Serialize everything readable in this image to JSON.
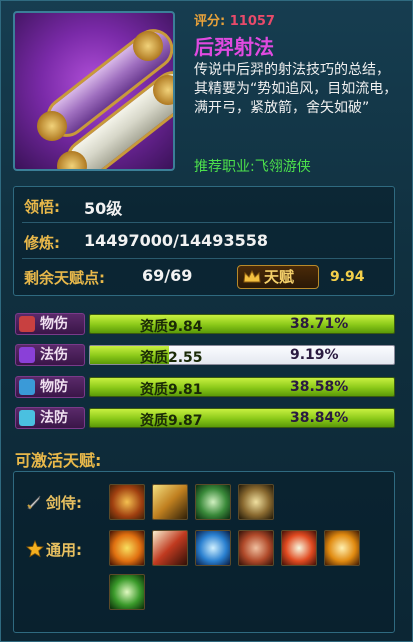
{
  "skill": {
    "score_label": "评分:",
    "score_value": "11057",
    "name": "后羿射法",
    "description": "传说中后羿的射法技巧的总结，其精要为“势如追风，目如流电，满开弓，紧放箭，舍矢如破”",
    "recommend": "推荐职业:飞翎游侠"
  },
  "info": {
    "comprehension_label": "领悟:",
    "comprehension_value": "50级",
    "cultivation_label": "修炼:",
    "cultivation_value": "14497000/14493558",
    "remaining_label": "剩余天赋点:",
    "remaining_value": "69/69",
    "talent_button": "天赋",
    "talent_value": "9.94"
  },
  "stats": [
    {
      "label": "物伤",
      "quality": "资质9.84",
      "percent": "38.71%",
      "fill": 1.0,
      "gem_color": "#c84040"
    },
    {
      "label": "法伤",
      "quality": "资质2.55",
      "percent": "9.19%",
      "fill": 0.26,
      "gem_color": "#8a40d8"
    },
    {
      "label": "物防",
      "quality": "资质9.81",
      "percent": "38.58%",
      "fill": 1.0,
      "gem_color": "#3a9ad8"
    },
    {
      "label": "法防",
      "quality": "资质9.87",
      "percent": "38.84%",
      "fill": 1.0,
      "gem_color": "#4ac0e0"
    }
  ],
  "activatable": {
    "title": "可激活天赋:",
    "sword_label": "剑侍:",
    "general_label": "通用:",
    "sword_icons": [
      "sword-strike-icon",
      "sword-slash-icon",
      "sword-green-icon",
      "sword-burst-icon"
    ],
    "general_icons": [
      "fire-body-icon",
      "arrow-burst-icon",
      "blue-aura-icon",
      "fist-icon",
      "flame-figure-icon",
      "sun-burst-icon",
      "green-figure-icon"
    ]
  },
  "colors": {
    "accent_gold": "#e8b84a",
    "skill_name": "#e04ae0",
    "recommend_green": "#4ce04c",
    "score_red": "#e84a6a",
    "bar_green": "#8ac818"
  }
}
